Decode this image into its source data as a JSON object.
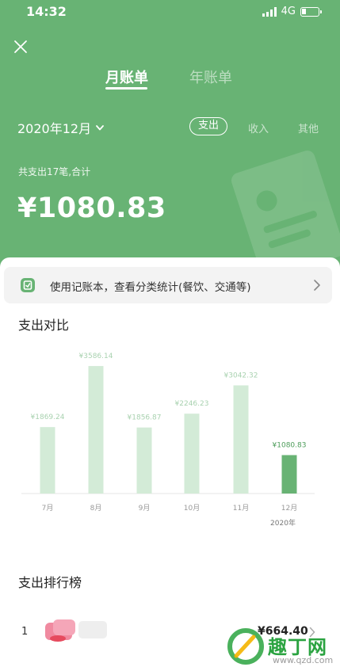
{
  "status_bar": {
    "time": "14:32",
    "network": "4G"
  },
  "tabs": {
    "month": "月账单",
    "year": "年账单"
  },
  "date_selector": {
    "label": "2020年12月"
  },
  "filters": {
    "expense": "支出",
    "income": "收入",
    "other": "其他"
  },
  "summary": {
    "text": "共支出17笔,合计",
    "amount": "¥1080.83"
  },
  "tip": {
    "text": "使用记账本，查看分类统计(餐饮、交通等)"
  },
  "compare": {
    "title": "支出对比"
  },
  "chart_data": {
    "type": "bar",
    "categories": [
      "7月",
      "8月",
      "9月",
      "10月",
      "11月",
      "12月"
    ],
    "values": [
      1869.24,
      3586.14,
      1856.87,
      2246.23,
      3042.32,
      1080.83
    ],
    "value_labels": [
      "¥1869.24",
      "¥3586.14",
      "¥1856.87",
      "¥2246.23",
      "¥3042.32",
      "¥1080.83"
    ],
    "year_label": "2020年",
    "highlight_index": 5,
    "colors": {
      "normal": "#d3ebd7",
      "highlight": "#68b374",
      "label_normal": "#a9d2b0",
      "label_highlight": "#4c9c59"
    },
    "ylim": [
      0,
      3900
    ]
  },
  "ranking": {
    "title": "支出排行榜",
    "items": [
      {
        "rank": "1",
        "amount": "¥664.40"
      }
    ]
  },
  "watermark": {
    "text": "趣丁网",
    "url": "www.qzd.com"
  },
  "colors": {
    "accent": "#68b374",
    "banner_bg": "#f3f3f3"
  }
}
